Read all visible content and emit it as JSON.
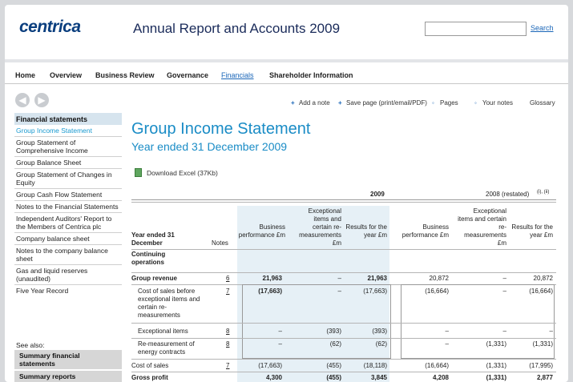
{
  "header": {
    "logo": "centrica",
    "title": "Annual Report and Accounts 2009",
    "search_label": "Search"
  },
  "nav": [
    "Home",
    "Overview",
    "Business Review",
    "Governance",
    "Financials",
    "Shareholder Information"
  ],
  "tools": {
    "back": "◀",
    "forward": "▶",
    "add_note": "Add a note",
    "save_page": "Save page (print/email/PDF)",
    "pages": "Pages",
    "your_notes": "Your notes",
    "glossary": "Glossary"
  },
  "sidebar": {
    "heading": "Financial statements",
    "items": [
      "Group Income Statement",
      "Group Statement of Comprehensive Income",
      "Group Balance Sheet",
      "Group Statement of Changes in Equity",
      "Group Cash Flow Statement",
      "Notes to the Financial Statements",
      "Independent Auditors' Report to the Members of Centrica plc",
      "Company balance sheet",
      "Notes to the company balance sheet",
      "Gas and liquid reserves (unaudited)",
      "Five Year Record"
    ],
    "see_also": "See also:",
    "bottom": [
      "Summary financial statements",
      "Summary reports"
    ]
  },
  "main": {
    "title": "Group Income Statement",
    "subtitle": "Year ended 31 December 2009",
    "download": "Download Excel (37Kb)"
  },
  "table": {
    "year2009": "2009",
    "year2008": "2008 (restated)",
    "refs2008": "(i), (ii)",
    "col_year": "Year ended 31 December",
    "col_notes": "Notes",
    "cols": [
      "Business performance £m",
      "Exceptional items and certain re-measurements £m",
      "Results for the year £m",
      "Business performance £m",
      "Exceptional items and certain re-measurements £m",
      "Results for the year £m"
    ],
    "section": "Continuing operations",
    "rows": [
      {
        "label": "Group revenue",
        "note": "6",
        "values": [
          "21,963",
          "–",
          "21,963",
          "20,872",
          "–",
          "20,872"
        ],
        "bold": true
      },
      {
        "label": "Cost of sales before exceptional items and certain re-measurements",
        "note": "7",
        "values": [
          "(17,663)",
          "–",
          "(17,663)",
          "(16,664)",
          "–",
          "(16,664)"
        ]
      },
      {
        "label": "Exceptional items",
        "note": "8",
        "values": [
          "–",
          "(393)",
          "(393)",
          "–",
          "–",
          "–"
        ]
      },
      {
        "label": "Re-measurement of energy contracts",
        "note": "8",
        "values": [
          "–",
          "(62)",
          "(62)",
          "–",
          "(1,331)",
          "(1,331)"
        ]
      },
      {
        "label": "Cost of sales",
        "note": "7",
        "values": [
          "(17,663)",
          "(455)",
          "(18,118)",
          "(16,664)",
          "(1,331)",
          "(17,995)"
        ]
      },
      {
        "label": "Gross profit",
        "note": "",
        "values": [
          "4,300",
          "(455)",
          "3,845",
          "4,208",
          "(1,331)",
          "2,877"
        ],
        "bold": true
      }
    ]
  }
}
